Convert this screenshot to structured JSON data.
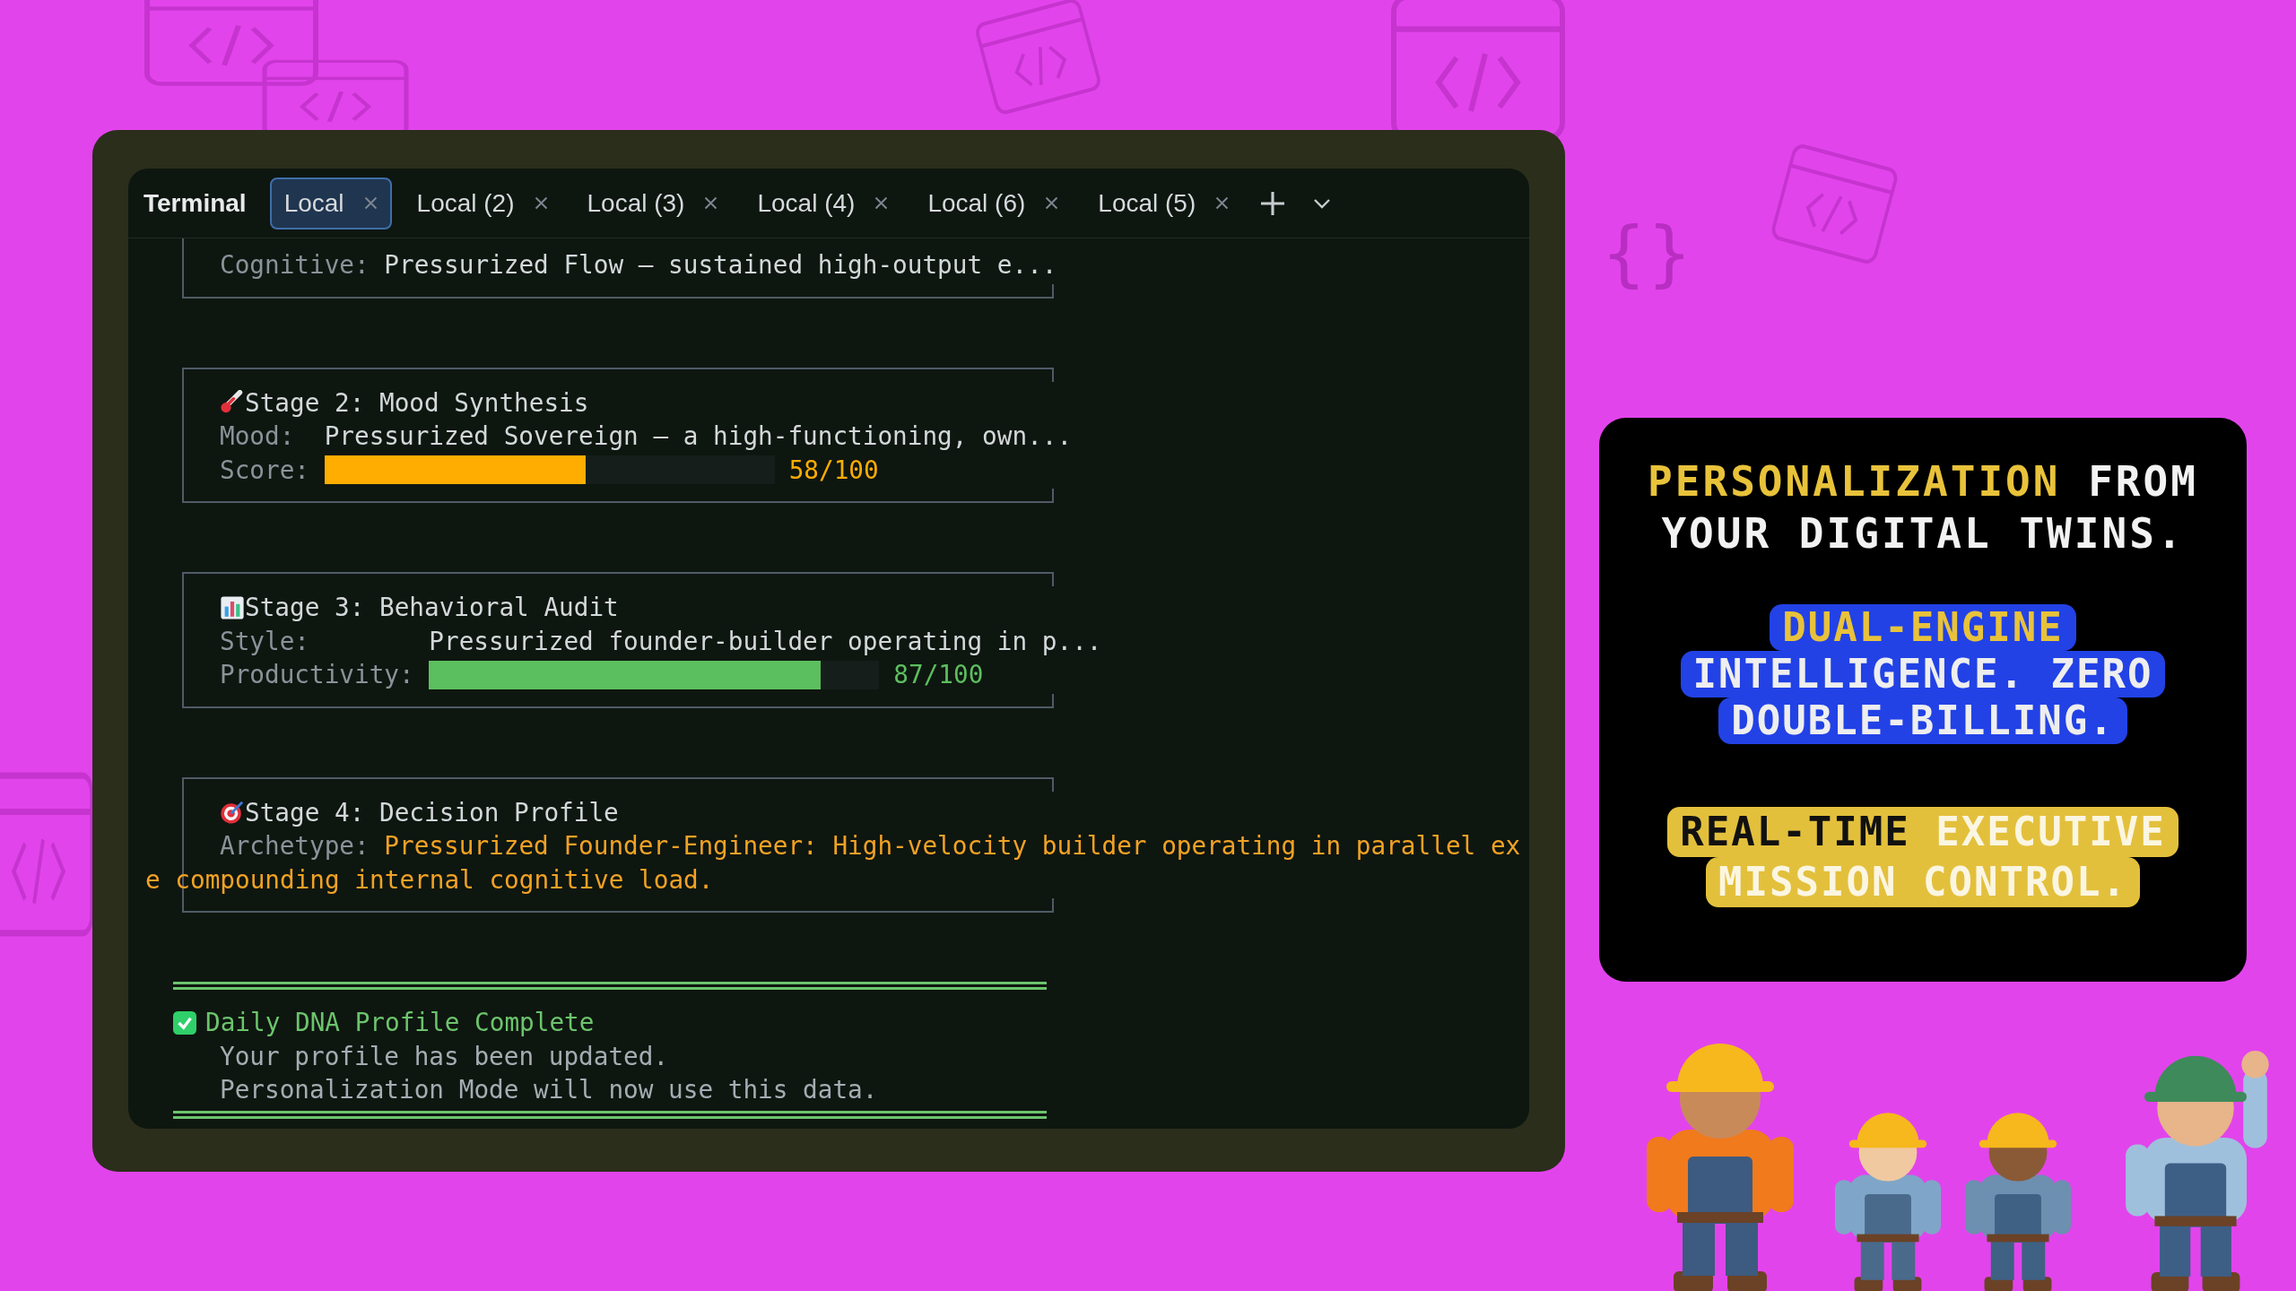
{
  "terminal": {
    "title": "Terminal",
    "tabs": [
      {
        "label": "Local",
        "selected": true
      },
      {
        "label": "Local (2)",
        "selected": false
      },
      {
        "label": "Local (3)",
        "selected": false
      },
      {
        "label": "Local (4)",
        "selected": false
      },
      {
        "label": "Local (6)",
        "selected": false
      },
      {
        "label": "Local (5)",
        "selected": false
      }
    ],
    "stages": [
      {
        "rows": [
          {
            "kind": "text",
            "label": "Cognitive:",
            "value": "Pressurized Flow — sustained high-output e...",
            "highlight": false
          }
        ]
      },
      {
        "title": "Stage 2: Mood Synthesis",
        "rows": [
          {
            "kind": "text",
            "label": "Mood:",
            "value": "Pressurized Sovereign — a high-functioning, own...",
            "highlight": false
          },
          {
            "kind": "bar",
            "label": "Score:",
            "level": 0.58,
            "reading": "58/100",
            "color": "#ffad00"
          }
        ]
      },
      {
        "title": "Stage 3: Behavioral Audit",
        "rows": [
          {
            "kind": "text",
            "label": "Style:",
            "value": "Pressurized founder-builder operating in p...",
            "highlight": false
          },
          {
            "kind": "bar",
            "label": "Productivity:",
            "level": 0.87,
            "reading": "87/100",
            "color": "#5cbf5f"
          }
        ]
      },
      {
        "title": "Stage 4: Decision Profile",
        "rows": [
          {
            "kind": "text",
            "label": "Archetype:",
            "value": "Pressurized Founder-Engineer: High-velocity builder operating in parallel ex",
            "highlight": true,
            "wrap": "e compounding internal cognitive load."
          }
        ]
      }
    ],
    "completion": {
      "checked": true,
      "title": "Daily DNA Profile Complete",
      "lines": [
        "Your profile has been updated.",
        "Personalization Mode will now use this data."
      ]
    }
  },
  "decor_braces": "{}",
  "promo": {
    "headline": [
      {
        "text": "PERSONALIZATION",
        "accent": true
      },
      {
        "text": "FROM YOUR DIGITAL TWINS.",
        "accent": false
      }
    ],
    "badges": [
      {
        "kind": "blue",
        "lines": [
          [
            {
              "text": "DUAL-ENGINE",
              "accent": true
            }
          ],
          [
            {
              "text": "INTELLIGENCE. ZERO",
              "accent": false
            }
          ],
          [
            {
              "text": "DOUBLE-BILLING.",
              "accent": false
            }
          ]
        ]
      },
      {
        "kind": "yellow",
        "lines": [
          [
            {
              "text": "REAL-TIME",
              "accent": true
            },
            {
              "text": "EXECUTIVE",
              "accent": false
            }
          ],
          [
            {
              "text": "MISSION CONTROL.",
              "accent": false
            }
          ]
        ]
      }
    ]
  }
}
